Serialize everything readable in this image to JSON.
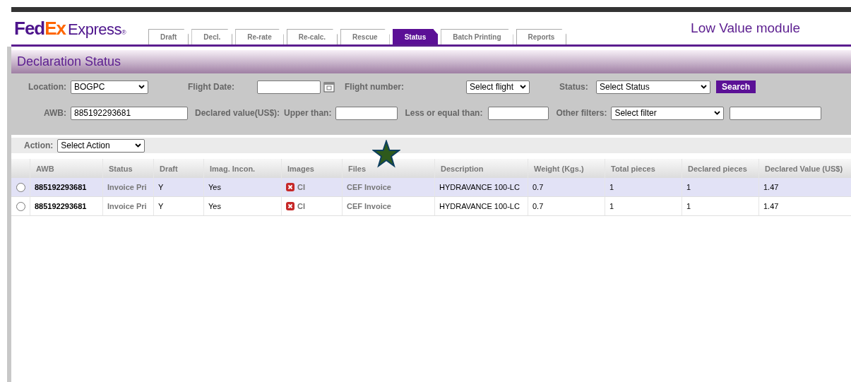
{
  "logo": {
    "fed": "Fed",
    "ex": "Ex",
    "express": "Express",
    "reg": "®"
  },
  "tabs": [
    {
      "label": "Draft",
      "selected": false
    },
    {
      "label": "Decl.",
      "selected": false
    },
    {
      "label": "Re-rate",
      "selected": false
    },
    {
      "label": "Re-calc.",
      "selected": false
    },
    {
      "label": "Rescue",
      "selected": false
    },
    {
      "label": "Status",
      "selected": true
    },
    {
      "label": "Batch Printing",
      "selected": false
    },
    {
      "label": "Reports",
      "selected": false
    }
  ],
  "module_title": "Low Value module",
  "page_title": "Declaration Status",
  "filters": {
    "location_label": "Location:",
    "location_value": "BOGPC",
    "flight_date_label": "Flight Date:",
    "flight_number_label": "Flight number:",
    "flight_value": "Select flight",
    "status_label": "Status:",
    "status_value": "Select Status",
    "search_button": "Search",
    "awb_label": "AWB:",
    "awb_value": "885192293681",
    "declared_label": "Declared value(US$):",
    "upper_label": "Upper than:",
    "less_label": "Less or equal than:",
    "other_label": "Other filters:",
    "other_value": "Select filter"
  },
  "action": {
    "label": "Action:",
    "value": "Select Action"
  },
  "table": {
    "columns": [
      "AWB",
      "Status",
      "Draft",
      "Imag. Incon.",
      "Images",
      "Files",
      "Description",
      "Weight (Kgs.)",
      "Total pieces",
      "Declared pieces",
      "Declared Value (US$)"
    ],
    "rows": [
      {
        "selected": false,
        "highlighted": true,
        "awb": "885192293681",
        "status": "Invoice Pri",
        "draft": "Y",
        "imag_incon": "Yes",
        "images": "CI",
        "files": "CEF  Invoice",
        "description": "HYDRAVANCE 100-LC",
        "weight": "0.7",
        "total_pieces": "1",
        "declared_pieces": "1",
        "declared_value": "1.47"
      },
      {
        "selected": false,
        "highlighted": false,
        "awb": "885192293681",
        "status": "Invoice Pri",
        "draft": "Y",
        "imag_incon": "Yes",
        "images": "CI",
        "files": "CEF  Invoice",
        "description": "HYDRAVANCE 100-LC",
        "weight": "0.7",
        "total_pieces": "1",
        "declared_pieces": "1",
        "declared_value": "1.47"
      }
    ]
  }
}
